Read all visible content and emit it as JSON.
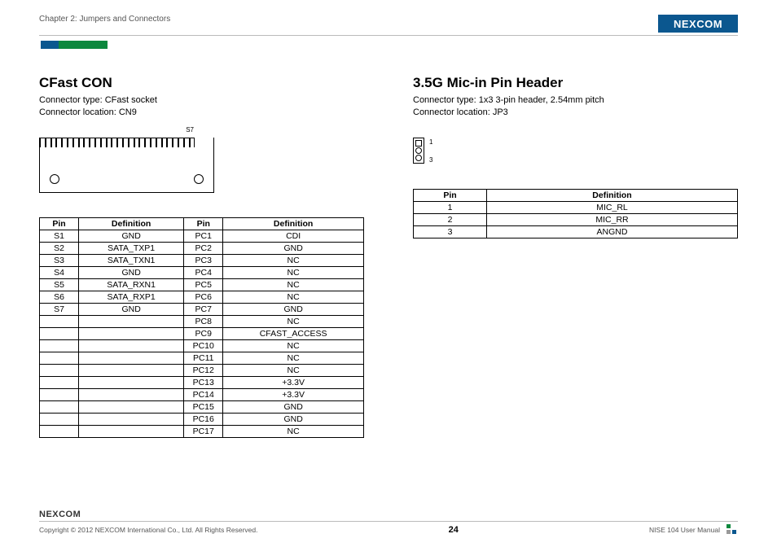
{
  "header": {
    "chapter": "Chapter 2: Jumpers and Connectors",
    "brand": "NEXCOM"
  },
  "left": {
    "title": "CFast CON",
    "type_line": "Connector type: CFast socket",
    "loc_line": "Connector location: CN9",
    "diagram_pin_label": "S7",
    "table_headers": {
      "pin": "Pin",
      "def": "Definition"
    },
    "rows": [
      {
        "p1": "S1",
        "d1": "GND",
        "p2": "PC1",
        "d2": "CDI"
      },
      {
        "p1": "S2",
        "d1": "SATA_TXP1",
        "p2": "PC2",
        "d2": "GND"
      },
      {
        "p1": "S3",
        "d1": "SATA_TXN1",
        "p2": "PC3",
        "d2": "NC"
      },
      {
        "p1": "S4",
        "d1": "GND",
        "p2": "PC4",
        "d2": "NC"
      },
      {
        "p1": "S5",
        "d1": "SATA_RXN1",
        "p2": "PC5",
        "d2": "NC"
      },
      {
        "p1": "S6",
        "d1": "SATA_RXP1",
        "p2": "PC6",
        "d2": "NC"
      },
      {
        "p1": "S7",
        "d1": "GND",
        "p2": "PC7",
        "d2": "GND"
      },
      {
        "p1": "",
        "d1": "",
        "p2": "PC8",
        "d2": "NC"
      },
      {
        "p1": "",
        "d1": "",
        "p2": "PC9",
        "d2": "CFAST_ACCESS"
      },
      {
        "p1": "",
        "d1": "",
        "p2": "PC10",
        "d2": "NC"
      },
      {
        "p1": "",
        "d1": "",
        "p2": "PC11",
        "d2": "NC"
      },
      {
        "p1": "",
        "d1": "",
        "p2": "PC12",
        "d2": "NC"
      },
      {
        "p1": "",
        "d1": "",
        "p2": "PC13",
        "d2": "+3.3V"
      },
      {
        "p1": "",
        "d1": "",
        "p2": "PC14",
        "d2": "+3.3V"
      },
      {
        "p1": "",
        "d1": "",
        "p2": "PC15",
        "d2": "GND"
      },
      {
        "p1": "",
        "d1": "",
        "p2": "PC16",
        "d2": "GND"
      },
      {
        "p1": "",
        "d1": "",
        "p2": "PC17",
        "d2": "NC"
      }
    ]
  },
  "right": {
    "title": "3.5G Mic-in Pin Header",
    "type_line": "Connector type: 1x3 3-pin header, 2.54mm pitch",
    "loc_line": "Connector location: JP3",
    "diagram_labels": {
      "top": "1",
      "bottom": "3"
    },
    "table_headers": {
      "pin": "Pin",
      "def": "Definition"
    },
    "rows": [
      {
        "p": "1",
        "d": "MIC_RL"
      },
      {
        "p": "2",
        "d": "MIC_RR"
      },
      {
        "p": "3",
        "d": "ANGND"
      }
    ]
  },
  "footer": {
    "brand": "NEXCOM",
    "copyright": "Copyright © 2012 NEXCOM International Co., Ltd. All Rights Reserved.",
    "page": "24",
    "manual": "NISE 104 User Manual"
  }
}
